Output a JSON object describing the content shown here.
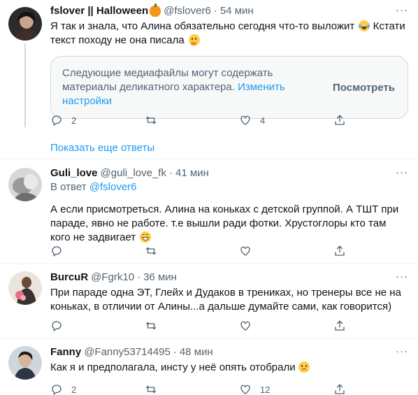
{
  "tweets": [
    {
      "name": "fslover || Halloween",
      "handle": "@fslover6",
      "sep": "·",
      "time": "54 мин",
      "text_part1": "Я так и знала, что Алина обязательно сегодня что-то выложит",
      "text_part2": "Кстати текст походу не она писала",
      "sensitive_text": "Следующие медиафайлы могут содержать материалы деликатного характера.",
      "sensitive_link": "Изменить настройки",
      "sensitive_button": "Посмотреть",
      "replies": "2",
      "retweets": "",
      "likes": "4"
    },
    {
      "name": "Guli_love",
      "handle": "@guli_love_fk",
      "sep": "·",
      "time": "41 мин",
      "reply_prefix": "В ответ",
      "reply_handle": "@fslover6",
      "text": "А если присмотреться. Алина на коньках с детской группой. А ТШТ при параде, явно не работе. т.е вышли ради фотки. Хрустоглоры кто там кого не задвигает",
      "replies": "",
      "retweets": "",
      "likes": ""
    },
    {
      "name": "BurcuR",
      "handle": "@Fgrk10",
      "sep": "·",
      "time": "36 мин",
      "text": "При параде одна ЭТ, Глейх и Дудаков в трениках, но тренеры все не на коньках, в отличии от Алины...а дальше думайте сами, как говорится)",
      "replies": "",
      "retweets": "",
      "likes": ""
    },
    {
      "name": "Fanny",
      "handle": "@Fanny53714495",
      "sep": "·",
      "time": "48 мин",
      "text": "Как я и предполагала, инсту у неё опять отобрали",
      "replies": "2",
      "retweets": "",
      "likes": "12"
    }
  ],
  "show_more": "Показать еще ответы",
  "more_glyph": "···",
  "icons": {
    "reply": "reply-icon",
    "retweet": "retweet-icon",
    "like": "like-icon",
    "share": "share-icon",
    "pumpkin": "pumpkin-emoji",
    "laugh": "tears-of-joy-emoji",
    "thinking": "thinking-emoji",
    "grin": "grinning-emoji",
    "worried": "slightly-frowning-emoji"
  },
  "colors": {
    "accent": "#1d9bf0",
    "secondary_text": "#536471",
    "primary_text": "#0f1419",
    "border": "#cfd9de"
  }
}
